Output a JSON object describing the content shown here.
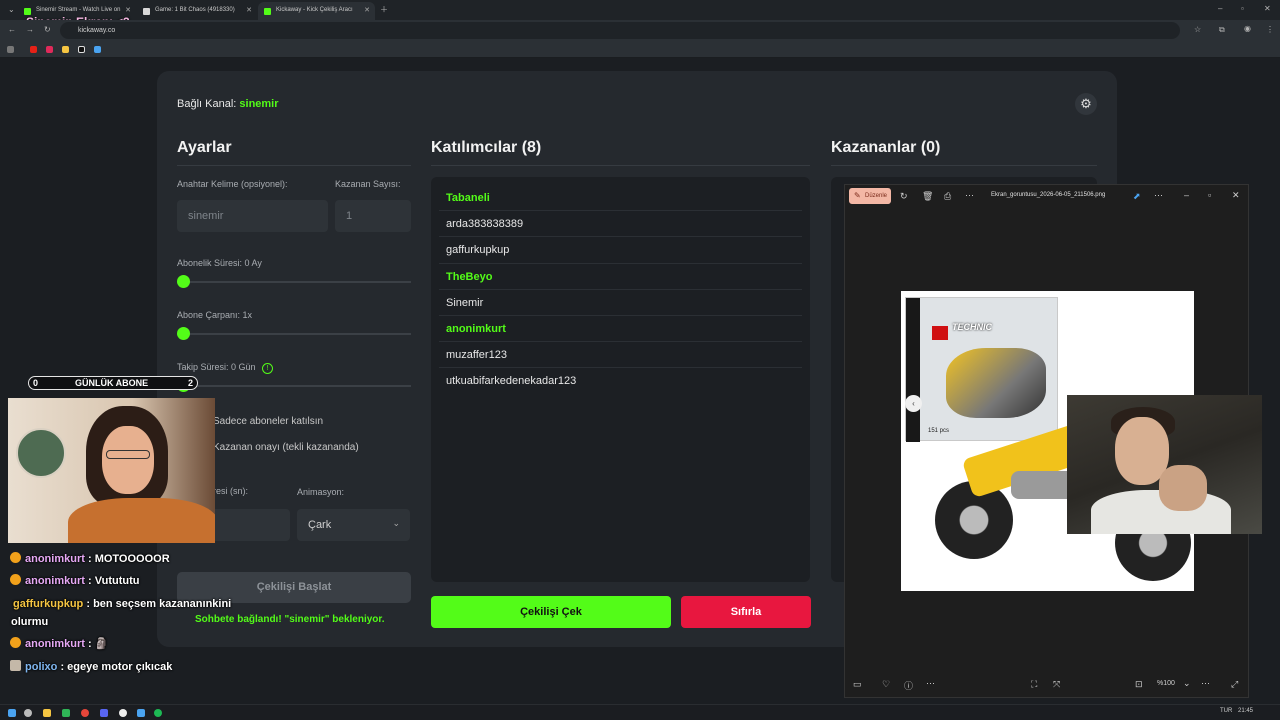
{
  "browser": {
    "tabs": [
      {
        "title": "Sinemir Stream - Watch Live on",
        "active": false,
        "favicon_color": "#53fc18"
      },
      {
        "title": "Game: 1 Bit Chaos (4918330)",
        "active": false,
        "favicon_color": "#d8d8d8"
      },
      {
        "title": "Kickaway - Kick Çekiliş Aracı",
        "active": true,
        "favicon_color": "#53fc18"
      }
    ],
    "url": "kickaway.co"
  },
  "stream_overlay": {
    "title": "Sinemin Ekranı <3",
    "goal": {
      "current": "0",
      "label": "GÜNLÜK ABONE",
      "target": "2"
    },
    "chat": [
      {
        "user": "anonimkurt",
        "message": ": MOTOOOOOR",
        "badge": "circle"
      },
      {
        "user": "anonimkurt",
        "message": ": Vutututu",
        "badge": "circle"
      },
      {
        "user": "gaffurkupkup",
        "message": ": ben seçsem kazananınkini",
        "badge": "none"
      },
      {
        "user": "",
        "message": "olurmu",
        "badge": "none"
      },
      {
        "user": "anonimkurt",
        "message": ": 🗿",
        "badge": "circle"
      },
      {
        "user": "polixo",
        "message": ": egeye motor çıkıcak",
        "badge": "square"
      }
    ]
  },
  "app": {
    "connected_label": "Bağlı Kanal:",
    "connected_channel": "sinemir",
    "settings": {
      "heading": "Ayarlar",
      "keyword_label": "Anahtar Kelime (opsiyonel):",
      "keyword_placeholder": "sinemir",
      "winner_count_label": "Kazanan Sayısı:",
      "winner_count_placeholder": "1",
      "sub_duration_label": "Abonelik Süresi: 0 Ay",
      "sub_multiplier_label": "Abone Çarpanı: 1x",
      "follow_duration_label": "Takip Süresi:  0  Gün",
      "only_subs_label": "Sadece aboneler katılsın",
      "winner_confirm_label": "Kazanan onayı (tekli kazananda)",
      "duration_label": "resi (sn):",
      "animation_label": "Animasyon:",
      "animation_value": "Çark",
      "start_button": "Çekilişi Başlat",
      "status_message": "Sohbete bağlandı! \"sinemir\" bekleniyor."
    },
    "participants": {
      "heading": "Katılımcılar (8)",
      "items": [
        {
          "name": "Tabaneli",
          "subscriber": true
        },
        {
          "name": "arda383838389",
          "subscriber": false
        },
        {
          "name": "gaffurkupkup",
          "subscriber": false
        },
        {
          "name": "TheBeyo",
          "subscriber": true
        },
        {
          "name": "Sinemir",
          "subscriber": false
        },
        {
          "name": "anonimkurt",
          "subscriber": true
        },
        {
          "name": "muzaffer123",
          "subscriber": false
        },
        {
          "name": "utkuabifarkedenekadar123",
          "subscriber": false
        }
      ],
      "draw_button": "Çekilişi Çek",
      "reset_button": "Sıfırla"
    },
    "winners": {
      "heading": "Kazananlar (0)"
    }
  },
  "image_viewer": {
    "edit_button": "Düzenle",
    "file_name": "Ekran_goruntusu_2026-06-05_211506.png",
    "zoom": "%100",
    "box_brand": "TECHNIC",
    "box_pieces": "151 pcs"
  },
  "taskbar": {
    "time": "21:45",
    "lang": "TUR"
  },
  "colors": {
    "kick_green": "#53fc18",
    "reset_red": "#e8173f",
    "panel": "#25292e",
    "list_bg": "#1c1f23"
  }
}
